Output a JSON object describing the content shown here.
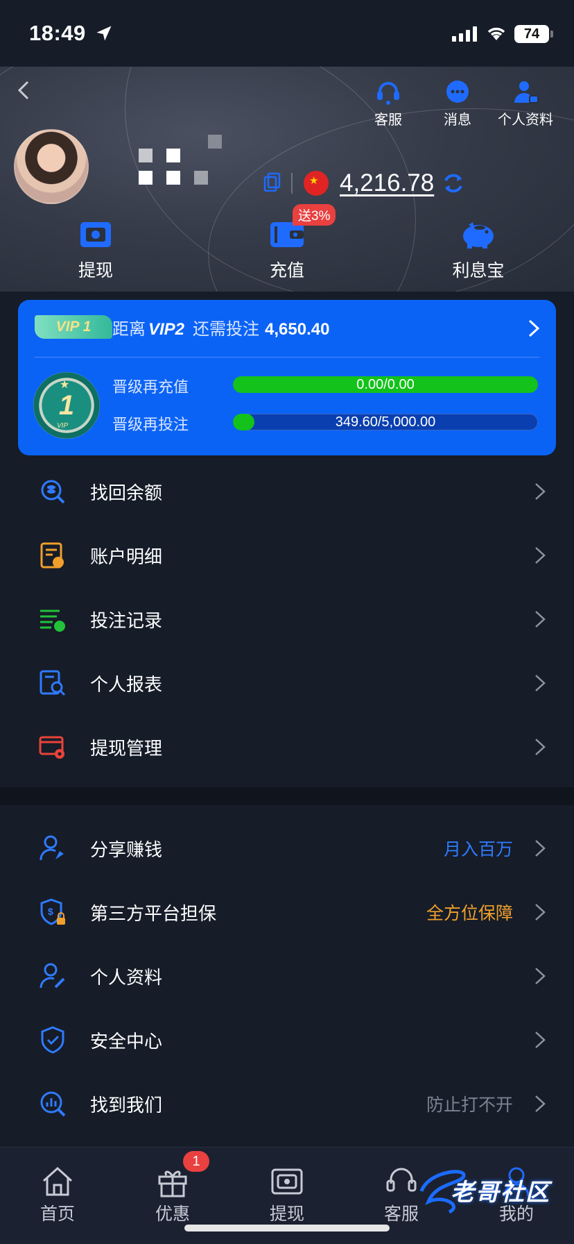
{
  "status_bar": {
    "time": "18:49",
    "battery": "74"
  },
  "header": {
    "top_icons": [
      {
        "label": "客服",
        "icon": "headset-icon"
      },
      {
        "label": "消息",
        "icon": "message-icon"
      },
      {
        "label": "个人资料",
        "icon": "profile-icon"
      }
    ],
    "balance": "4,216.78",
    "actions": [
      {
        "label": "提现",
        "icon": "withdraw-icon"
      },
      {
        "label": "充值",
        "icon": "wallet-icon",
        "badge": "送3%"
      },
      {
        "label": "利息宝",
        "icon": "piggy-bank-icon"
      }
    ]
  },
  "vip": {
    "current_level": "VIP 1",
    "distance_prefix": "距离",
    "next_level": "VIP2",
    "need_label": "还需投注",
    "need_amount": "4,650.40",
    "medal_number": "1",
    "medal_text": "VIP",
    "progress": [
      {
        "label": "晋级再充值",
        "text": "0.00/0.00",
        "fraction": 1.0
      },
      {
        "label": "晋级再投注",
        "text": "349.60/5,000.00",
        "fraction": 0.0699
      }
    ]
  },
  "menu_group_1": [
    {
      "label": "找回余额",
      "icon": "search-coin-icon",
      "color": "#2f7bff"
    },
    {
      "label": "账户明细",
      "icon": "account-detail-icon",
      "color": "#f0a02a"
    },
    {
      "label": "投注记录",
      "icon": "bet-record-icon",
      "color": "#22c23a"
    },
    {
      "label": "个人报表",
      "icon": "report-icon",
      "color": "#2f7bff"
    },
    {
      "label": "提现管理",
      "icon": "withdraw-manage-icon",
      "color": "#e8433a"
    }
  ],
  "menu_group_2": [
    {
      "label": "分享赚钱",
      "icon": "share-user-icon",
      "extra": "月入百万",
      "extra_color": "#2f7bff"
    },
    {
      "label": "第三方平台担保",
      "icon": "shield-dollar-icon",
      "extra": "全方位保障",
      "extra_color": "#f0a02a"
    },
    {
      "label": "个人资料",
      "icon": "user-edit-icon",
      "extra": "",
      "extra_color": ""
    },
    {
      "label": "安全中心",
      "icon": "shield-check-icon",
      "extra": "",
      "extra_color": ""
    },
    {
      "label": "找到我们",
      "icon": "find-us-icon",
      "extra": "防止打不开",
      "extra_color": "#7c8392"
    }
  ],
  "tabbar": {
    "tabs": [
      {
        "label": "首页",
        "icon": "home-icon"
      },
      {
        "label": "优惠",
        "icon": "gift-icon"
      },
      {
        "label": "提现",
        "icon": "withdraw-tab-icon"
      },
      {
        "label": "客服",
        "icon": "headset-tab-icon"
      },
      {
        "label": "我的",
        "icon": "user-tab-icon"
      }
    ],
    "promo_badge": "1"
  },
  "watermark": "老哥社区",
  "colors": {
    "primary": "#0b63f6",
    "progress": "#13c21a",
    "background": "#161c28",
    "badge": "#e94040"
  }
}
